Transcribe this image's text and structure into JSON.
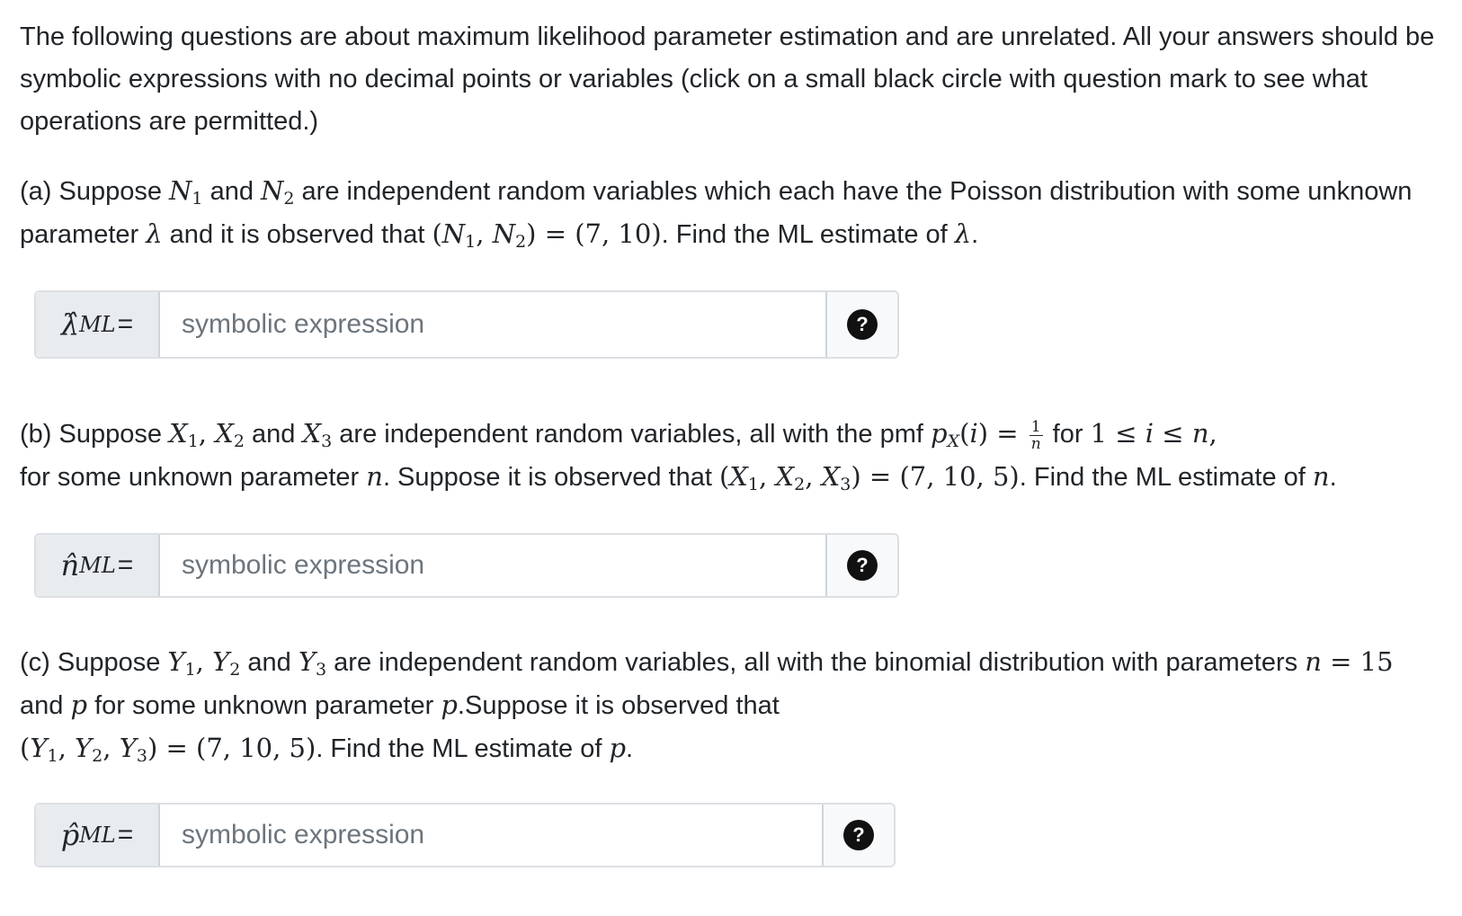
{
  "intro": "The following questions are about maximum likelihood parameter estimation and are unrelated. All your answers should be symbolic expressions with no decimal points or variables (click on a small black circle with question mark to see what operations are permitted.)",
  "part_a": {
    "t1": "(a) Suppose ",
    "t2": " and ",
    "t3": " are independent random variables which each have the Poisson distribution with some unknown parameter ",
    "t4": " and it is observed that ",
    "t5": ". Find the ML estimate of ",
    "t6": ".",
    "answer_label": "λ̂",
    "answer_placeholder": "symbolic expression"
  },
  "part_b": {
    "t1": "(b) Suppose ",
    "t2": " and ",
    "t3": " are independent random variables, all with the pmf ",
    "t4": " for ",
    "t5": "for some unknown parameter ",
    "t6": ". Suppose it is observed that ",
    "t7": ". Find the ML estimate of ",
    "t8": ".",
    "answer_label": "n̂",
    "answer_placeholder": "symbolic expression"
  },
  "part_c": {
    "t1": "(c) Suppose ",
    "t2": " and ",
    "t3": " are independent random variables, all with the binomial distribution with parameters ",
    "t4": " and ",
    "t5": " for some unknown parameter ",
    "t6": ".Suppose it is observed that ",
    "t7": ". Find the ML estimate of ",
    "t8": ".",
    "answer_label": "p̂",
    "answer_placeholder": "symbolic expression"
  },
  "label_subscript": "ML",
  "label_equals": "=",
  "help_symbol": "?"
}
